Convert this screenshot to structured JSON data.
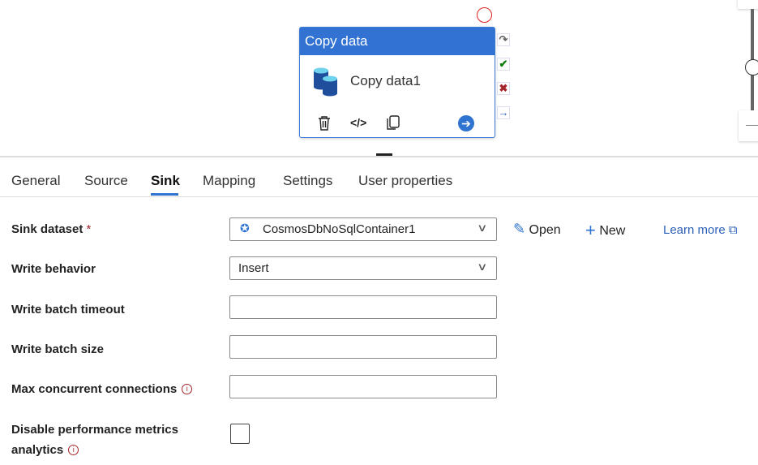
{
  "activity": {
    "type": "Copy data",
    "name": "Copy data1"
  },
  "tabs": [
    {
      "label": "General"
    },
    {
      "label": "Source"
    },
    {
      "label": "Sink",
      "active": true
    },
    {
      "label": "Mapping"
    },
    {
      "label": "Settings"
    },
    {
      "label": "User properties"
    }
  ],
  "form": {
    "sink_dataset": {
      "label": "Sink dataset",
      "required": "*",
      "value": "CosmosDbNoSqlContainer1",
      "open": "Open",
      "new": "New",
      "learn_more": "Learn more"
    },
    "write_behavior": {
      "label": "Write behavior",
      "value": "Insert"
    },
    "write_batch_timeout": {
      "label": "Write batch timeout",
      "value": ""
    },
    "write_batch_size": {
      "label": "Write batch size",
      "value": ""
    },
    "max_concurrent_connections": {
      "label": "Max concurrent connections",
      "value": ""
    },
    "disable_metrics": {
      "label_line1": "Disable performance metrics",
      "label_line2": "analytics",
      "checked": false
    }
  },
  "colors": {
    "accent": "#3272d2",
    "link": "#2b5fb8",
    "error": "#a4262c",
    "success": "#107c10"
  }
}
